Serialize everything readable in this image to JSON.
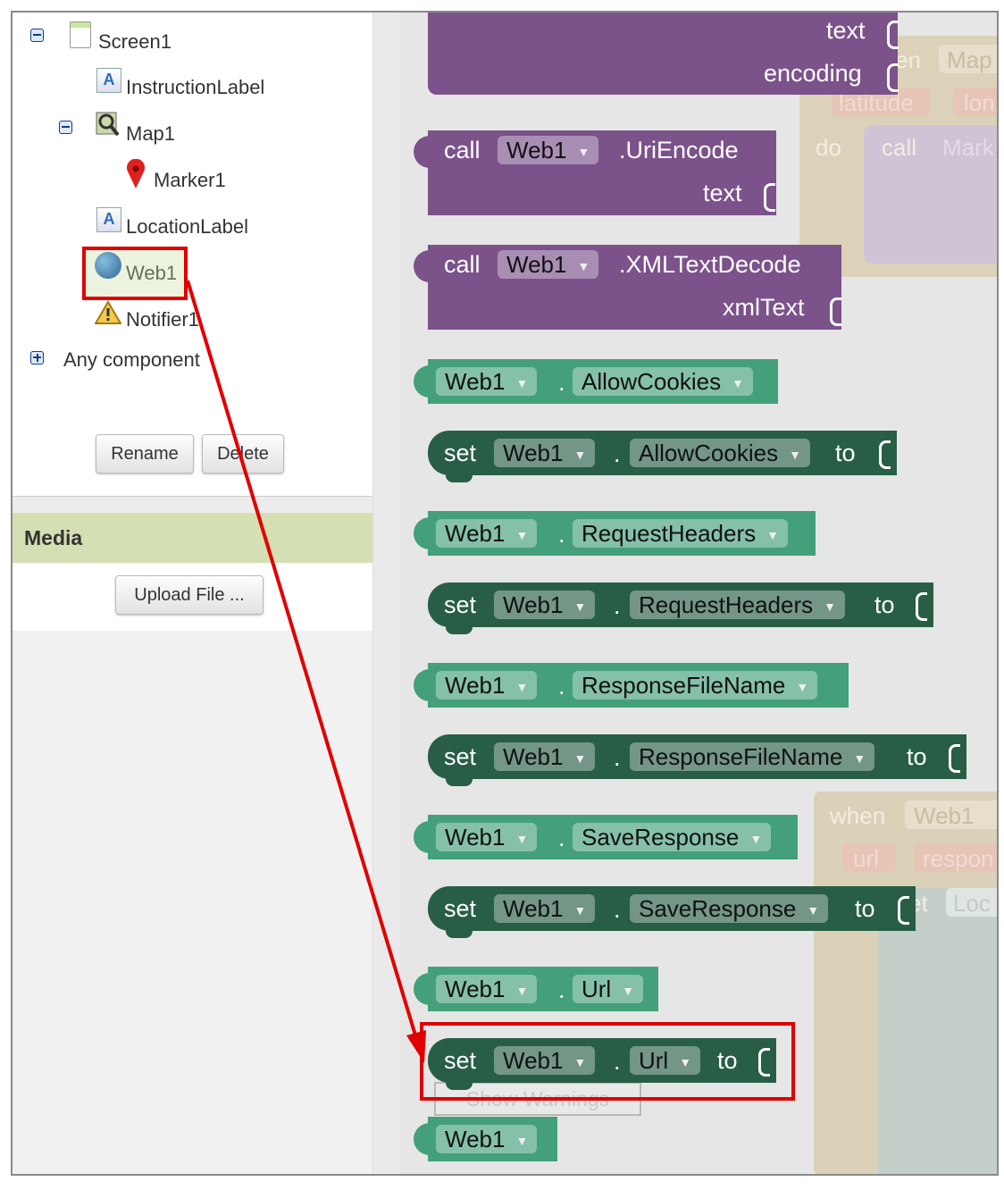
{
  "tree": {
    "screen": "Screen1",
    "instruction_label": "InstructionLabel",
    "map": "Map1",
    "marker": "Marker1",
    "location_label": "LocationLabel",
    "web": "Web1",
    "notifier": "Notifier1",
    "any_component": "Any component"
  },
  "buttons": {
    "rename": "Rename",
    "delete": "Delete",
    "upload": "Upload File ..."
  },
  "media": {
    "title": "Media"
  },
  "blocks": {
    "text": "text",
    "encoding": "encoding",
    "call": "call",
    "web1": "Web1",
    "uriencode": ".UriEncode",
    "xmltextdecode": ".XMLTextDecode",
    "xmltext": "xmlText",
    "dot": ".",
    "set": "set",
    "to": "to",
    "allow_cookies": "AllowCookies",
    "request_headers": "RequestHeaders",
    "response_file_name": "ResponseFileName",
    "save_response": "SaveResponse",
    "url": "Url",
    "show_warnings": "Show Warnings"
  },
  "ghost": {
    "when1": "en",
    "map": "Map",
    "latitude": "latitude",
    "lon": "lon",
    "do": "do",
    "call": "call",
    "mark": "Mark",
    "when2": "when",
    "web1": "Web1",
    "url": "url",
    "respon": "respon",
    "set": "et",
    "loc": "Loc"
  },
  "colors": {
    "highlight": "#e00000",
    "purple": "#7c528b",
    "light_green": "#44a07a",
    "dark_green": "#285e46"
  }
}
